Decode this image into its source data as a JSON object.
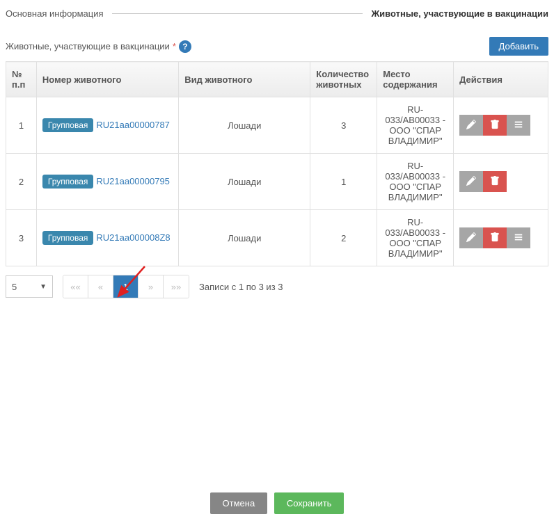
{
  "tabs": {
    "main_info": "Основная информация",
    "animals": "Животные, участвующие в вакцинации"
  },
  "section": {
    "title": "Животные, участвующие в вакцинации",
    "required_mark": "*",
    "help": "?"
  },
  "buttons": {
    "add": "Добавить",
    "cancel": "Отмена",
    "save": "Сохранить"
  },
  "table": {
    "headers": {
      "idx": "№ п.п",
      "number": "Номер животного",
      "kind": "Вид животного",
      "qty": "Количество животных",
      "place": "Место содержания",
      "actions": "Действия"
    },
    "rows": [
      {
        "idx": "1",
        "badge": "Групповая",
        "number": "RU21aa00000787",
        "kind": "Лошади",
        "qty": "3",
        "place": "RU-033/AB00033 - ООО \"СПАР ВЛАДИМИР\"",
        "show_list": true
      },
      {
        "idx": "2",
        "badge": "Групповая",
        "number": "RU21aa00000795",
        "kind": "Лошади",
        "qty": "1",
        "place": "RU-033/AB00033 - ООО \"СПАР ВЛАДИМИР\"",
        "show_list": false
      },
      {
        "idx": "3",
        "badge": "Групповая",
        "number": "RU21aa000008Z8",
        "kind": "Лошади",
        "qty": "2",
        "place": "RU-033/AB00033 - ООО \"СПАР ВЛАДИМИР\"",
        "show_list": true
      }
    ]
  },
  "pagination": {
    "page_size": "5",
    "current": "1",
    "info": "Записи с 1 по 3 из 3"
  }
}
